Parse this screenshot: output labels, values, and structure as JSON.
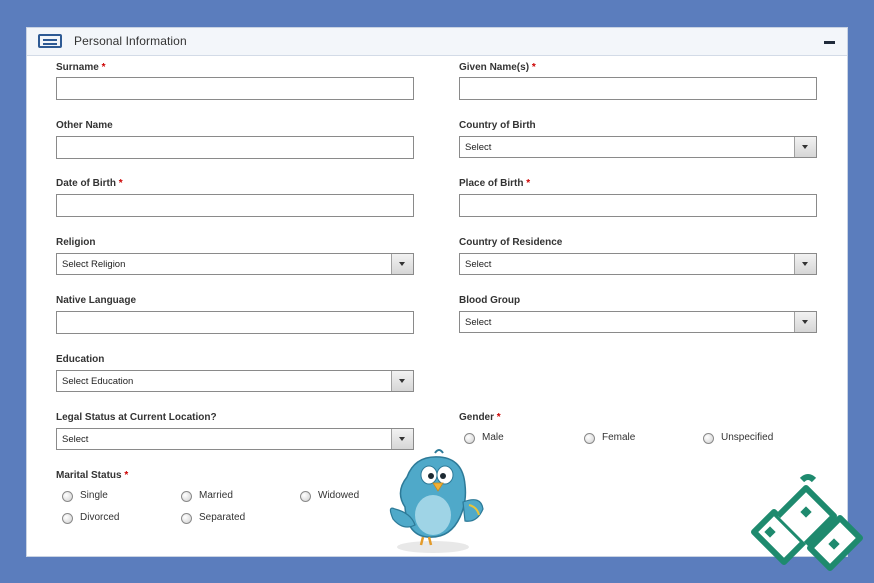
{
  "header": {
    "title": "Personal Information",
    "icon": "id-card-icon",
    "collapse_icon": "collapse-icon"
  },
  "left_fields": {
    "surname": {
      "label": "Surname",
      "required": "*",
      "value": ""
    },
    "other_name": {
      "label": "Other Name",
      "value": ""
    },
    "date_of_birth": {
      "label": "Date of Birth",
      "required": "*",
      "value": ""
    },
    "religion": {
      "label": "Religion",
      "selected": "Select Religion"
    },
    "native_language": {
      "label": "Native Language",
      "value": ""
    },
    "education": {
      "label": "Education",
      "selected": "Select Education"
    },
    "legal_status": {
      "label": "Legal Status at Current Location?",
      "selected": "Select"
    },
    "marital_status": {
      "label": "Marital Status",
      "required": "*",
      "options": [
        "Single",
        "Married",
        "Widowed",
        "Divorced",
        "Separated"
      ]
    }
  },
  "right_fields": {
    "given_names": {
      "label": "Given Name(s)",
      "required": "*",
      "value": ""
    },
    "country_of_birth": {
      "label": "Country of Birth",
      "selected": "Select"
    },
    "place_of_birth": {
      "label": "Place of Birth",
      "required": "*",
      "value": ""
    },
    "country_of_residence": {
      "label": "Country of Residence",
      "selected": "Select"
    },
    "blood_group": {
      "label": "Blood Group",
      "selected": "Select"
    },
    "gender": {
      "label": "Gender",
      "required": "*",
      "options": [
        "Male",
        "Female",
        "Unspecified"
      ]
    }
  },
  "colors": {
    "background": "#5b7dbd",
    "panel_header": "#f3f6fa",
    "required": "#cc0000",
    "mascot_body": "#4fa9c9",
    "logo": "#1e8a6e"
  }
}
